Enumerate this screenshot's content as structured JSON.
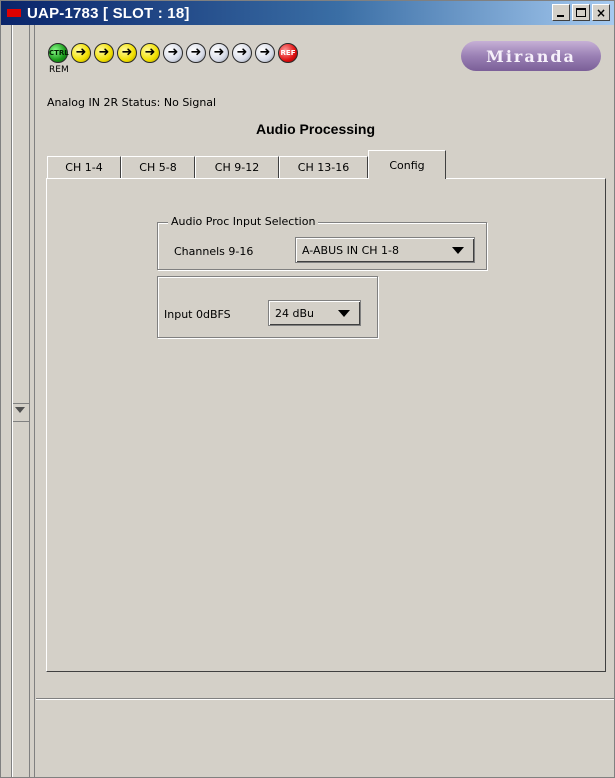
{
  "window": {
    "title": "UAP-1783 [ SLOT : 18]",
    "buttons": {
      "minimize": "_",
      "maximize": "□",
      "close": "×"
    }
  },
  "status_leds": {
    "ctrl": "CTRL",
    "ref": "REF",
    "rem": "REM",
    "arrow_glyph": "➜",
    "colors": {
      "ctrl": "#1a9a1a",
      "yellow": "#f2e000",
      "white": "#d8dce8",
      "ref": "#e01010"
    }
  },
  "brand": {
    "logo_text": "Miranda",
    "color": "#8c6fae"
  },
  "status_text": "Analog IN 2R Status: No Signal",
  "page_title": "Audio Processing",
  "tabs": [
    {
      "label": "CH 1-4"
    },
    {
      "label": "CH 5-8"
    },
    {
      "label": "CH 9-12"
    },
    {
      "label": "CH 13-16"
    },
    {
      "label": "Config"
    }
  ],
  "active_tab": "Config",
  "config": {
    "input_selection": {
      "legend": "Audio Proc Input Selection",
      "label": "Channels 9-16",
      "value": "A-ABUS IN CH 1-8"
    },
    "input_0dbfs": {
      "label": "Input 0dBFS",
      "value": "24 dBu"
    }
  }
}
